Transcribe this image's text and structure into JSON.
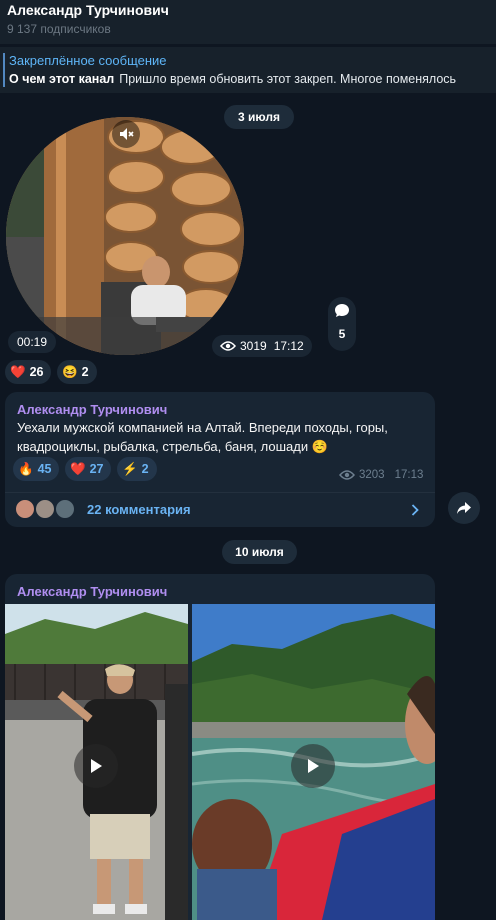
{
  "channel": {
    "name": "Александр Турчинович",
    "subscribers": "9 137 подписчиков"
  },
  "pinned": {
    "label": "Закреплённое сообщение",
    "bold_text": "О чем этот канал",
    "text": "Пришло время обновить этот закреп. Многое поменялось"
  },
  "dates": [
    "3 июля",
    "10 июля"
  ],
  "round_video": {
    "duration": "00:19",
    "views": "3019",
    "time": "17:12",
    "comments_count": "5",
    "reactions": [
      {
        "emoji": "❤️",
        "count": "26"
      },
      {
        "emoji": "😆",
        "count": "2"
      }
    ]
  },
  "post1": {
    "author": "Александр Турчинович",
    "text_line1": "Уехали мужской компанией на Алтай. Впереди походы, горы,",
    "text_line2": "квадроциклы, рыбалка, стрельба, баня, лошади",
    "text_emoji": "☺️",
    "reactions": [
      {
        "emoji": "🔥",
        "count": "45"
      },
      {
        "emoji": "❤️",
        "count": "27"
      },
      {
        "emoji": "⚡",
        "count": "2"
      }
    ],
    "views": "3203",
    "time": "17:13",
    "comments_label": "22 комментария"
  },
  "post2": {
    "author": "Александр Турчинович"
  },
  "colors": {
    "background": "#0e1621",
    "bubble": "#182533",
    "accent": "#6ab3f3",
    "author": "#b08ef0"
  }
}
